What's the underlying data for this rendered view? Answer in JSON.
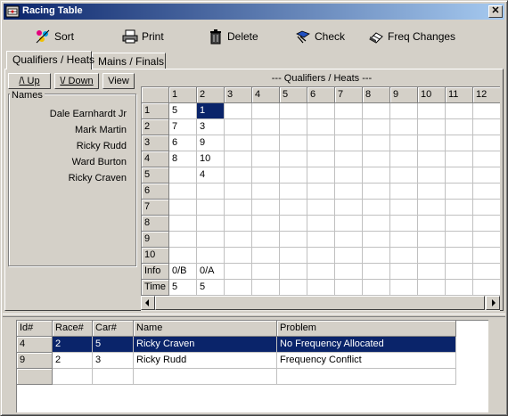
{
  "window": {
    "title": "Racing Table",
    "close_glyph": "✕"
  },
  "toolbar": {
    "sort": {
      "label": "Sort",
      "icon": "sort-icon"
    },
    "print": {
      "label": "Print",
      "icon": "printer-icon"
    },
    "delete": {
      "label": "Delete",
      "icon": "trash-icon"
    },
    "check": {
      "label": "Check",
      "icon": "check-icon"
    },
    "freq": {
      "label": "Freq Changes",
      "icon": "eraser-icon"
    }
  },
  "tabs": [
    {
      "label": "Qualifiers / Heats",
      "active": true
    },
    {
      "label": "Mains / Finals",
      "active": false
    }
  ],
  "controls": {
    "up_label": "/\\ Up",
    "down_label": "\\/ Down",
    "view_label": "View"
  },
  "names": {
    "legend": "Names",
    "items": [
      "Dale Earnhardt Jr",
      "Mark Martin",
      "Ricky Rudd",
      "Ward Burton",
      "Ricky Craven"
    ]
  },
  "grid": {
    "title": "--- Qualifiers / Heats ---",
    "column_headers": [
      "1",
      "2",
      "3",
      "4",
      "5",
      "6",
      "7",
      "8",
      "9",
      "10",
      "11",
      "12"
    ],
    "row_headers": [
      "1",
      "2",
      "3",
      "4",
      "5",
      "6",
      "7",
      "8",
      "9",
      "10",
      "Info",
      "Time"
    ],
    "cells": [
      [
        "5",
        "1",
        "",
        "",
        "",
        "",
        "",
        "",
        "",
        "",
        "",
        ""
      ],
      [
        "7",
        "3",
        "",
        "",
        "",
        "",
        "",
        "",
        "",
        "",
        "",
        ""
      ],
      [
        "6",
        "9",
        "",
        "",
        "",
        "",
        "",
        "",
        "",
        "",
        "",
        ""
      ],
      [
        "8",
        "10",
        "",
        "",
        "",
        "",
        "",
        "",
        "",
        "",
        "",
        ""
      ],
      [
        "",
        "4",
        "",
        "",
        "",
        "",
        "",
        "",
        "",
        "",
        "",
        ""
      ],
      [
        "",
        "",
        "",
        "",
        "",
        "",
        "",
        "",
        "",
        "",
        "",
        ""
      ],
      [
        "",
        "",
        "",
        "",
        "",
        "",
        "",
        "",
        "",
        "",
        "",
        ""
      ],
      [
        "",
        "",
        "",
        "",
        "",
        "",
        "",
        "",
        "",
        "",
        "",
        ""
      ],
      [
        "",
        "",
        "",
        "",
        "",
        "",
        "",
        "",
        "",
        "",
        "",
        ""
      ],
      [
        "",
        "",
        "",
        "",
        "",
        "",
        "",
        "",
        "",
        "",
        "",
        ""
      ],
      [
        "0/B",
        "0/A",
        "",
        "",
        "",
        "",
        "",
        "",
        "",
        "",
        "",
        ""
      ],
      [
        "5",
        "5",
        "",
        "",
        "",
        "",
        "",
        "",
        "",
        "",
        "",
        ""
      ]
    ],
    "selected_cell": {
      "row": 0,
      "col": 1
    }
  },
  "problems": {
    "headers": [
      "Id#",
      "Race#",
      "Car#",
      "Name",
      "Problem"
    ],
    "rows": [
      {
        "id": "4",
        "race": "2",
        "car": "5",
        "name": "Ricky Craven",
        "problem": "No Frequency Allocated",
        "selected": true
      },
      {
        "id": "9",
        "race": "2",
        "car": "3",
        "name": "Ricky Rudd",
        "problem": "Frequency Conflict",
        "selected": false
      },
      {
        "id": "",
        "race": "",
        "car": "",
        "name": "",
        "problem": "",
        "selected": false
      }
    ]
  },
  "colors": {
    "selection": "#0a246a",
    "face": "#d4d0c8",
    "title_start": "#0a246a",
    "title_end": "#a6caf0"
  }
}
